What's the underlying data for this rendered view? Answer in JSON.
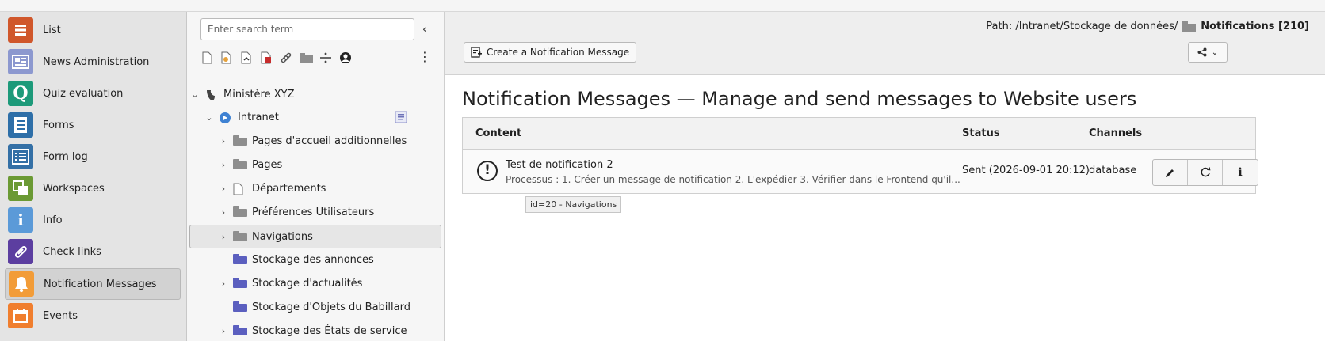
{
  "module_menu": {
    "items": [
      {
        "label": "List",
        "icon": "list-icon",
        "color": "#d0572b"
      },
      {
        "label": "News Administration",
        "icon": "news-icon",
        "color": "#8c98cf"
      },
      {
        "label": "Quiz evaluation",
        "icon": "quiz-icon",
        "color": "#1d9a7a"
      },
      {
        "label": "Forms",
        "icon": "forms-icon",
        "color": "#2e6fa8"
      },
      {
        "label": "Form log",
        "icon": "form-log-icon",
        "color": "#3470a6"
      },
      {
        "label": "Workspaces",
        "icon": "workspaces-icon",
        "color": "#6b9a34"
      },
      {
        "label": "Info",
        "icon": "info-icon",
        "color": "#5b9ad8"
      },
      {
        "label": "Check links",
        "icon": "check-links-icon",
        "color": "#5c3ea0"
      },
      {
        "label": "Notification Messages",
        "icon": "bell-icon",
        "color": "#f29c38",
        "active": true
      },
      {
        "label": "Events",
        "icon": "calendar-icon",
        "color": "#f07e2e"
      }
    ]
  },
  "page_tree": {
    "search_placeholder": "Enter search term",
    "toolbar_icons": [
      "new-page-icon",
      "new-page-inside-icon",
      "new-page-after-icon",
      "delete-page-icon",
      "link-icon",
      "folder-icon",
      "divider-icon",
      "backend-user-icon"
    ],
    "nodes": [
      {
        "label": "Ministère XYZ",
        "level": 0,
        "chevron": "down",
        "icon": "typo3-root-icon"
      },
      {
        "label": "Intranet",
        "level": 1,
        "chevron": "down",
        "icon": "globe-icon"
      },
      {
        "label": "Pages d'accueil additionnelles",
        "level": 2,
        "chevron": "right",
        "icon": "grey-folder-icon"
      },
      {
        "label": "Pages",
        "level": 2,
        "chevron": "right",
        "icon": "grey-folder-icon"
      },
      {
        "label": "Départements",
        "level": 2,
        "chevron": "right",
        "icon": "page-icon"
      },
      {
        "label": "Préférences Utilisateurs",
        "level": 2,
        "chevron": "right",
        "icon": "grey-folder-icon"
      },
      {
        "label": "Navigations",
        "level": 2,
        "chevron": "right",
        "icon": "grey-folder-icon",
        "selected": true
      },
      {
        "label": "Stockage des annonces",
        "level": 2,
        "chevron": "",
        "icon": "blue-folder-icon"
      },
      {
        "label": "Stockage d'actualités",
        "level": 2,
        "chevron": "right",
        "icon": "blue-folder-icon"
      },
      {
        "label": "Stockage d'Objets du Babillard",
        "level": 2,
        "chevron": "",
        "icon": "blue-folder-icon"
      },
      {
        "label": "Stockage des États de service",
        "level": 2,
        "chevron": "right",
        "icon": "blue-folder-icon"
      }
    ],
    "tooltip": "id=20 - Navigations"
  },
  "doc_header": {
    "path_prefix": "Path: /Intranet/Stockage de données/",
    "path_current": "Notifications [210]",
    "create_button_label": "Create a Notification Message"
  },
  "main": {
    "title": "Notification Messages — Manage and send messages to Website users",
    "table": {
      "headers": {
        "content": "Content",
        "status": "Status",
        "channels": "Channels"
      },
      "rows": [
        {
          "title": "Test de notification 2",
          "description": "Processus : 1. Créer un message de notification 2. L'expédier 3. Vérifier dans le Frontend qu'il...",
          "status": "Sent (2026-09-01 20:12)",
          "channels": "database",
          "actions": [
            "edit-icon",
            "resend-icon",
            "info-icon"
          ]
        }
      ]
    }
  }
}
